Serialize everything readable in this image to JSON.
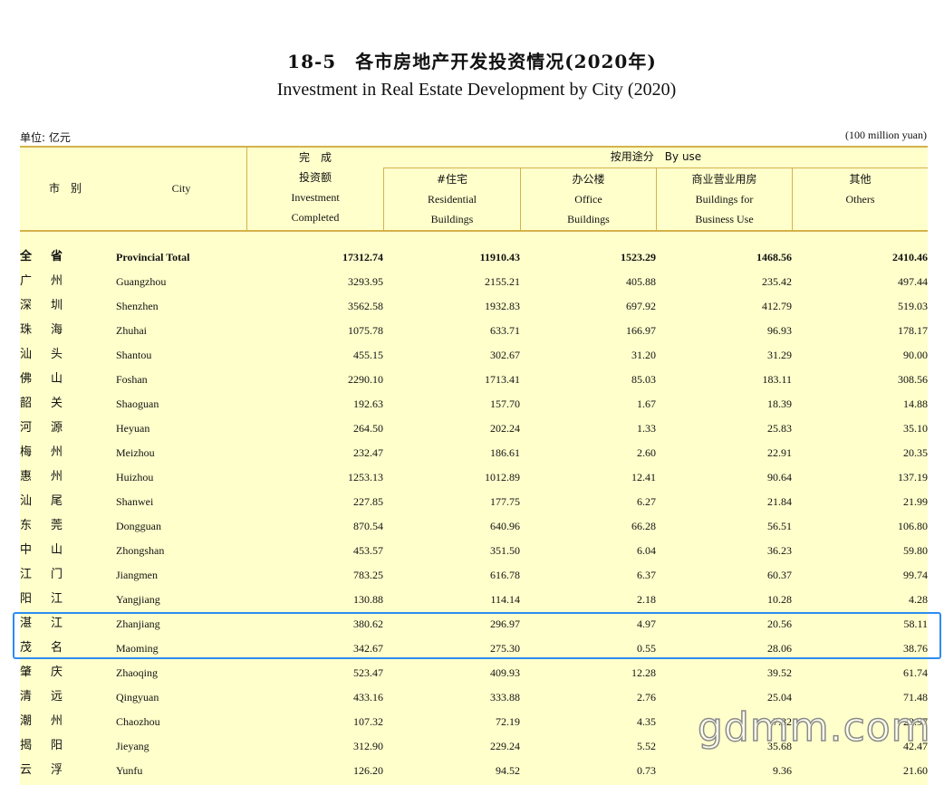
{
  "title_cn": "18-5　各市房地产开发投资情况(2020年)",
  "title_en": "Investment in Real Estate Development by City (2020)",
  "unit_cn": "单位: 亿元",
  "unit_en": "(100 million yuan)",
  "header": {
    "city_cn": "市　别",
    "city_en": "City",
    "completed_cn_top": "完　成",
    "completed_cn": "投资额",
    "completed_en1": "Investment",
    "completed_en2": "Completed",
    "byuse": "按用途分　By use",
    "residential_cn": "#住宅",
    "residential_en1": "Residential",
    "residential_en2": "Buildings",
    "office_cn": "办公楼",
    "office_en1": "Office",
    "office_en2": "Buildings",
    "business_cn": "商业营业用房",
    "business_en1": "Buildings for",
    "business_en2": "Business Use",
    "others_cn": "其他",
    "others_en": "Others"
  },
  "rows": [
    {
      "cn1": "全",
      "cn2": "省",
      "en": "Provincial Total",
      "v": [
        "17312.74",
        "11910.43",
        "1523.29",
        "1468.56",
        "2410.46"
      ]
    },
    {
      "cn1": "广",
      "cn2": "州",
      "en": "Guangzhou",
      "v": [
        "3293.95",
        "2155.21",
        "405.88",
        "235.42",
        "497.44"
      ]
    },
    {
      "cn1": "深",
      "cn2": "圳",
      "en": "Shenzhen",
      "v": [
        "3562.58",
        "1932.83",
        "697.92",
        "412.79",
        "519.03"
      ]
    },
    {
      "cn1": "珠",
      "cn2": "海",
      "en": "Zhuhai",
      "v": [
        "1075.78",
        "633.71",
        "166.97",
        "96.93",
        "178.17"
      ]
    },
    {
      "cn1": "汕",
      "cn2": "头",
      "en": "Shantou",
      "v": [
        "455.15",
        "302.67",
        "31.20",
        "31.29",
        "90.00"
      ]
    },
    {
      "cn1": "佛",
      "cn2": "山",
      "en": "Foshan",
      "v": [
        "2290.10",
        "1713.41",
        "85.03",
        "183.11",
        "308.56"
      ]
    },
    {
      "cn1": "韶",
      "cn2": "关",
      "en": "Shaoguan",
      "v": [
        "192.63",
        "157.70",
        "1.67",
        "18.39",
        "14.88"
      ]
    },
    {
      "cn1": "河",
      "cn2": "源",
      "en": "Heyuan",
      "v": [
        "264.50",
        "202.24",
        "1.33",
        "25.83",
        "35.10"
      ]
    },
    {
      "cn1": "梅",
      "cn2": "州",
      "en": "Meizhou",
      "v": [
        "232.47",
        "186.61",
        "2.60",
        "22.91",
        "20.35"
      ]
    },
    {
      "cn1": "惠",
      "cn2": "州",
      "en": "Huizhou",
      "v": [
        "1253.13",
        "1012.89",
        "12.41",
        "90.64",
        "137.19"
      ]
    },
    {
      "cn1": "汕",
      "cn2": "尾",
      "en": "Shanwei",
      "v": [
        "227.85",
        "177.75",
        "6.27",
        "21.84",
        "21.99"
      ]
    },
    {
      "cn1": "东",
      "cn2": "莞",
      "en": "Dongguan",
      "v": [
        "870.54",
        "640.96",
        "66.28",
        "56.51",
        "106.80"
      ]
    },
    {
      "cn1": "中",
      "cn2": "山",
      "en": "Zhongshan",
      "v": [
        "453.57",
        "351.50",
        "6.04",
        "36.23",
        "59.80"
      ]
    },
    {
      "cn1": "江",
      "cn2": "门",
      "en": "Jiangmen",
      "v": [
        "783.25",
        "616.78",
        "6.37",
        "60.37",
        "99.74"
      ]
    },
    {
      "cn1": "阳",
      "cn2": "江",
      "en": "Yangjiang",
      "v": [
        "130.88",
        "114.14",
        "2.18",
        "10.28",
        "4.28"
      ]
    },
    {
      "cn1": "湛",
      "cn2": "江",
      "en": "Zhanjiang",
      "v": [
        "380.62",
        "296.97",
        "4.97",
        "20.56",
        "58.11"
      ]
    },
    {
      "cn1": "茂",
      "cn2": "名",
      "en": "Maoming",
      "v": [
        "342.67",
        "275.30",
        "0.55",
        "28.06",
        "38.76"
      ]
    },
    {
      "cn1": "肇",
      "cn2": "庆",
      "en": "Zhaoqing",
      "v": [
        "523.47",
        "409.93",
        "12.28",
        "39.52",
        "61.74"
      ]
    },
    {
      "cn1": "清",
      "cn2": "远",
      "en": "Qingyuan",
      "v": [
        "433.16",
        "333.88",
        "2.76",
        "25.04",
        "71.48"
      ]
    },
    {
      "cn1": "潮",
      "cn2": "州",
      "en": "Chaozhou",
      "v": [
        "107.32",
        "72.19",
        "4.35",
        "7.82",
        "22.97"
      ]
    },
    {
      "cn1": "揭",
      "cn2": "阳",
      "en": "Jieyang",
      "v": [
        "312.90",
        "229.24",
        "5.52",
        "35.68",
        "42.47"
      ]
    },
    {
      "cn1": "云",
      "cn2": "浮",
      "en": "Yunfu",
      "v": [
        "126.20",
        "94.52",
        "0.73",
        "9.36",
        "21.60"
      ]
    }
  ],
  "watermark": "gdmm.com"
}
